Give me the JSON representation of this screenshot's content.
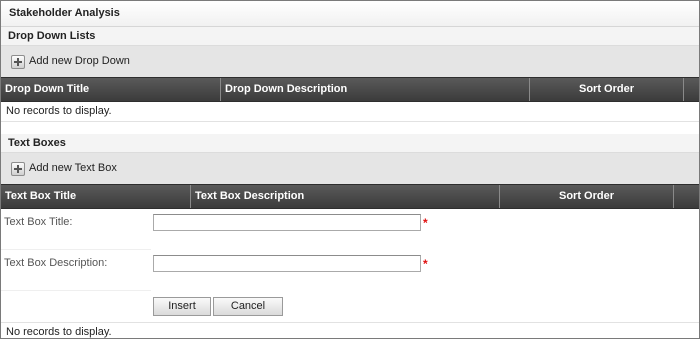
{
  "page": {
    "title": "Stakeholder Analysis"
  },
  "dropdown_section": {
    "heading": "Drop Down Lists",
    "add_label": "Add new Drop Down",
    "columns": [
      "Drop Down Title",
      "Drop Down Description",
      "Sort Order",
      ""
    ],
    "empty_text": "No records to display."
  },
  "textbox_section": {
    "heading": "Text Boxes",
    "add_label": "Add new Text Box",
    "columns": [
      "Text Box Title",
      "Text Box Description",
      "Sort Order",
      ""
    ],
    "form": {
      "title_label": "Text Box Title:",
      "title_value": "",
      "description_label": "Text Box Description:",
      "description_value": "",
      "required_mark": "*",
      "insert_label": "Insert",
      "cancel_label": "Cancel"
    },
    "empty_text": "No records to display."
  },
  "icons": {
    "add": "plus-square-icon"
  }
}
